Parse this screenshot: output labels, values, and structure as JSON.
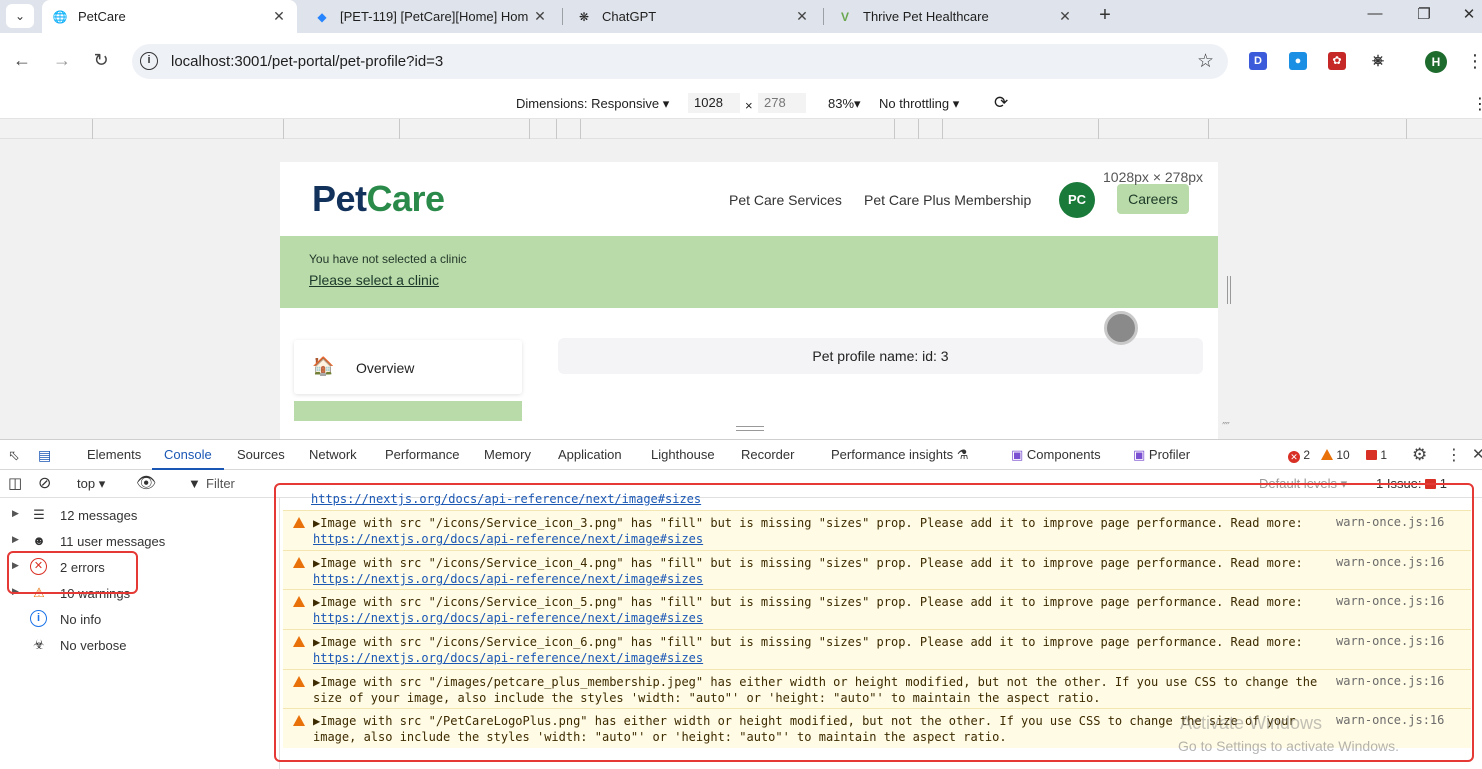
{
  "browser": {
    "tabs": [
      {
        "title": "PetCare",
        "icon": "globe-icon",
        "active": true
      },
      {
        "title": "[PET-119] [PetCare][Home] Hom",
        "icon": "jira-icon",
        "active": false
      },
      {
        "title": "ChatGPT",
        "icon": "chatgpt-icon",
        "active": false
      },
      {
        "title": "Thrive Pet Healthcare",
        "icon": "thrive-icon",
        "active": false
      }
    ],
    "url": "localhost:3001/pet-portal/pet-profile?id=3",
    "profile_initial": "H",
    "ext_labels": [
      "D"
    ]
  },
  "device_toolbar": {
    "dimensions": "Dimensions: Responsive",
    "width": "1028",
    "times": "×",
    "height": "278",
    "zoom": "83%",
    "throttling": "No throttling",
    "size_label": "1028px × 278px"
  },
  "site": {
    "logo_pet": "Pet",
    "logo_care": "Care",
    "nav": [
      "Pet Care Services",
      "Pet Care Plus Membership"
    ],
    "avatar": "PC",
    "careers": "Careers",
    "banner_message": "You have not selected a clinic",
    "banner_link": "Please select a clinic",
    "sidebar_item": "Overview",
    "profile_text": "Pet profile name: id: 3"
  },
  "devtools": {
    "tabs": [
      "Elements",
      "Console",
      "Sources",
      "Network",
      "Performance",
      "Memory",
      "Application",
      "Lighthouse",
      "Recorder",
      "Performance insights",
      "Components",
      "Profiler"
    ],
    "active_tab": "Console",
    "error_count": "2",
    "warning_count": "10",
    "issue_count": "1",
    "context": "top",
    "filter_placeholder": "Filter",
    "levels": "Default levels",
    "issues": "1 Issue:",
    "issues_count": "1"
  },
  "console_sidebar": [
    {
      "label": "12 messages",
      "icon": "list-icon"
    },
    {
      "label": "11 user messages",
      "icon": "user-icon"
    },
    {
      "label": "2 errors",
      "icon": "error-icon"
    },
    {
      "label": "10 warnings",
      "icon": "warning-icon"
    },
    {
      "label": "No info",
      "icon": "info-icon"
    },
    {
      "label": "No verbose",
      "icon": "bug-icon"
    }
  ],
  "console_log": {
    "top_link": "https://nextjs.org/docs/api-reference/next/image#sizes",
    "entries": [
      {
        "text": "▶Image with src \"/icons/Service_icon_3.png\" has \"fill\" but is missing \"sizes\" prop. Please add it to improve page performance. Read more:",
        "link": "https://nextjs.org/docs/api-reference/next/image#sizes",
        "source": "warn-once.js:16"
      },
      {
        "text": "▶Image with src \"/icons/Service_icon_4.png\" has \"fill\" but is missing \"sizes\" prop. Please add it to improve page performance. Read more:",
        "link": "https://nextjs.org/docs/api-reference/next/image#sizes",
        "source": "warn-once.js:16"
      },
      {
        "text": "▶Image with src \"/icons/Service_icon_5.png\" has \"fill\" but is missing \"sizes\" prop. Please add it to improve page performance. Read more:",
        "link": "https://nextjs.org/docs/api-reference/next/image#sizes",
        "source": "warn-once.js:16"
      },
      {
        "text": "▶Image with src \"/icons/Service_icon_6.png\" has \"fill\" but is missing \"sizes\" prop. Please add it to improve page performance. Read more:",
        "link": "https://nextjs.org/docs/api-reference/next/image#sizes",
        "source": "warn-once.js:16"
      },
      {
        "text": "▶Image with src \"/images/petcare_plus_membership.jpeg\" has either width or height modified, but not the other. If you use CSS to change the",
        "line2": "size of your image, also include the styles 'width: \"auto\"' or 'height: \"auto\"' to maintain the aspect ratio.",
        "source": "warn-once.js:16"
      },
      {
        "text": "▶Image with src \"/PetCareLogoPlus.png\" has either width or height modified, but not the other. If you use CSS to change the size of your",
        "line2": "image, also include the styles 'width: \"auto\"' or 'height: \"auto\"' to maintain the aspect ratio.",
        "source": "warn-once.js:16"
      }
    ]
  },
  "watermark": {
    "line1": "Activate Windows",
    "line2": "Go to Settings to activate Windows."
  }
}
